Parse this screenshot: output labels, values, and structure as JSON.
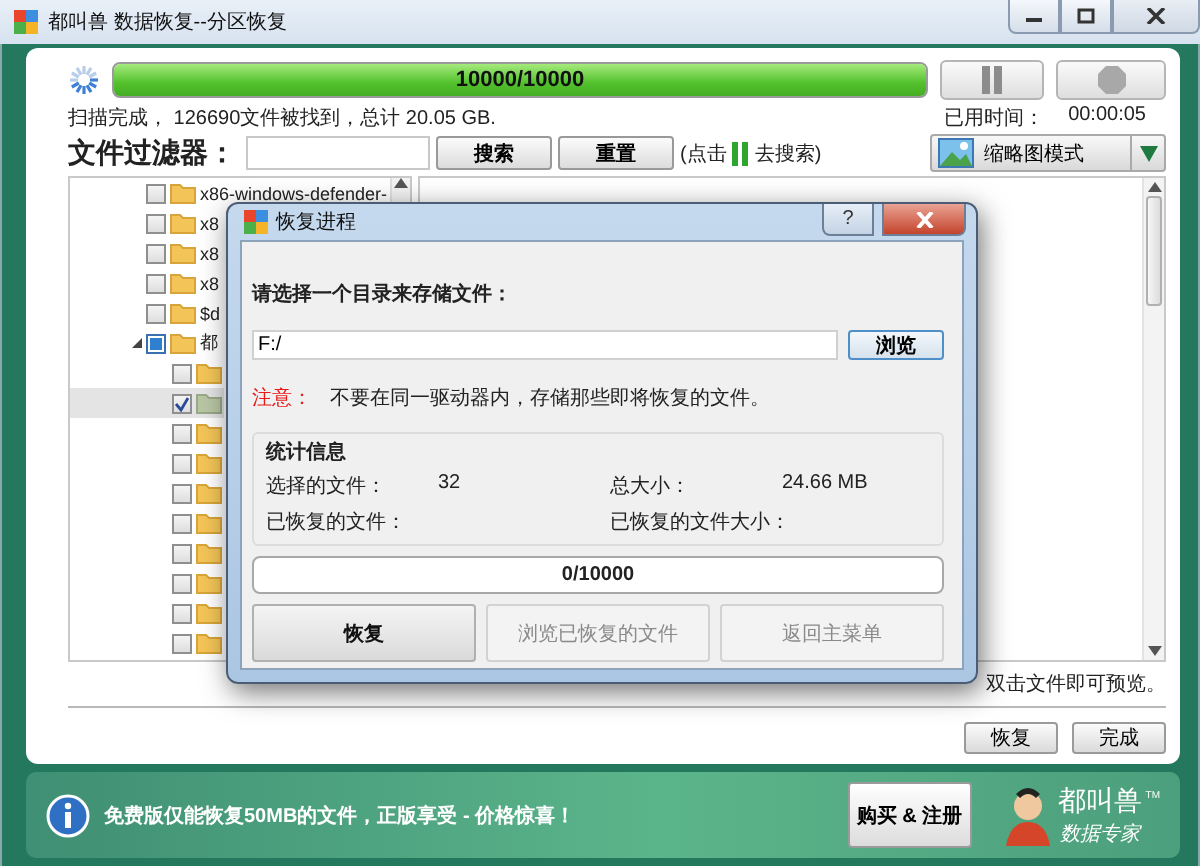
{
  "window": {
    "title": "都叫兽 数据恢复--分区恢复"
  },
  "scan": {
    "progress_text": "10000/10000",
    "level": 1,
    "summary": "扫描完成， 126690文件被找到，总计 20.05 GB.",
    "elapsed_label": "已用时间：",
    "elapsed": "00:00:05"
  },
  "filter": {
    "label": "文件过滤器：",
    "search_button": "搜索",
    "reset_button": "重置",
    "hint_before": "(点击",
    "hint_after": "去搜索)"
  },
  "view_mode": {
    "label": "缩略图模式"
  },
  "tree": [
    {
      "name": "x86-windows-defender-",
      "checked": false,
      "partial": false,
      "selected": false,
      "expanded": false
    },
    {
      "name": "x8",
      "checked": false,
      "partial": false,
      "selected": false,
      "expanded": false
    },
    {
      "name": "x8",
      "checked": false,
      "partial": false,
      "selected": false,
      "expanded": false
    },
    {
      "name": "x8",
      "checked": false,
      "partial": false,
      "selected": false,
      "expanded": false
    },
    {
      "name": "$d",
      "checked": false,
      "partial": false,
      "selected": false,
      "expanded": false
    },
    {
      "name": "都",
      "checked": false,
      "partial": true,
      "selected": false,
      "expanded": true,
      "children": [
        {
          "checked": false,
          "partial": false,
          "selected": false
        },
        {
          "checked": true,
          "partial": false,
          "selected": true
        },
        {
          "checked": false,
          "partial": false,
          "selected": false
        },
        {
          "checked": false,
          "partial": false,
          "selected": false
        },
        {
          "checked": false,
          "partial": false,
          "selected": false
        },
        {
          "checked": false,
          "partial": false,
          "selected": false
        },
        {
          "checked": false,
          "partial": false,
          "selected": false
        },
        {
          "checked": false,
          "partial": false,
          "selected": false
        },
        {
          "checked": false,
          "partial": false,
          "selected": false
        },
        {
          "checked": false,
          "partial": false,
          "selected": false
        }
      ]
    }
  ],
  "preview_hint": "双击文件即可预览。",
  "buttons": [
    {
      "label": "恢复"
    },
    {
      "label": "完成"
    }
  ],
  "dialog": {
    "title": "恢复进程",
    "help_button": "?",
    "prompt": "请选择一个目录来存储文件：",
    "path": "F:/",
    "browse_button": "浏览",
    "note_label": "注意：",
    "note": "不要在同一驱动器内，存储那些即将恢复的文件。",
    "stats": {
      "title": "统计信息",
      "items": [
        {
          "label": "选择的文件：",
          "value": "32"
        },
        {
          "label": "总大小：",
          "value": "24.66 MB"
        },
        {
          "label": "已恢复的文件："
        },
        {
          "label": "已恢复的文件大小："
        }
      ]
    },
    "progress": {
      "text": "0/10000",
      "level": 0
    },
    "actions": [
      {
        "label": "恢复",
        "disabled": false
      },
      {
        "label": "浏览已恢复的文件",
        "disabled": true
      },
      {
        "label": "返回主菜单",
        "disabled": true
      }
    ]
  },
  "promo": {
    "message": "免费版仅能恢复50MB的文件，正版享受 - 价格惊喜！",
    "buy_button": "购买 & 注册",
    "logo_name": "都叫兽",
    "logo_tagline": "数据专家",
    "trademark": "TM"
  }
}
